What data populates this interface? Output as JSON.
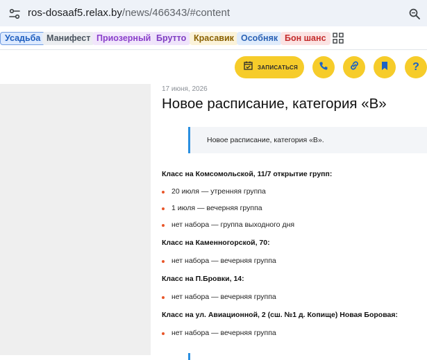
{
  "browser": {
    "url_host": "ros-dosaaf5.relax.by",
    "url_path": "/news/466343/#content"
  },
  "bookmarks": [
    {
      "label": "Усадьба"
    },
    {
      "label": "Манифест"
    },
    {
      "label": "Приозерный"
    },
    {
      "label": "Брутто"
    },
    {
      "label": "Красавик"
    },
    {
      "label": "Особняк"
    },
    {
      "label": "Бон шанс"
    }
  ],
  "toolbar": {
    "enroll_label": "ЗАПИСАТЬСЯ",
    "help_label": "?",
    "accent_color": "#f6cc2a",
    "icon_color": "#1d63c4"
  },
  "article": {
    "date": "17 июня, 2026",
    "title": "Новое расписание, категория «В»",
    "lead": "Новое расписание, категория «В».",
    "groups": [
      {
        "heading": "Класс на Комсомольской, 11/7 открытие групп:",
        "items": [
          "20 июля — утренняя группа",
          "1 июля — вечерняя группа",
          "нет набора — группа выходного дня"
        ]
      },
      {
        "heading": "Класс на Каменногорской, 70:",
        "items": [
          "нет набора — вечерняя группа"
        ]
      },
      {
        "heading": "Класс на П.Бровки, 14:",
        "items": [
          "нет набора — вечерняя группа"
        ]
      },
      {
        "heading": "Класс на ул. Авиационной, 2 (сш. №1 д. Копище) Новая Боровая:",
        "items": [
          "нет набора — вечерняя группа"
        ]
      }
    ]
  }
}
